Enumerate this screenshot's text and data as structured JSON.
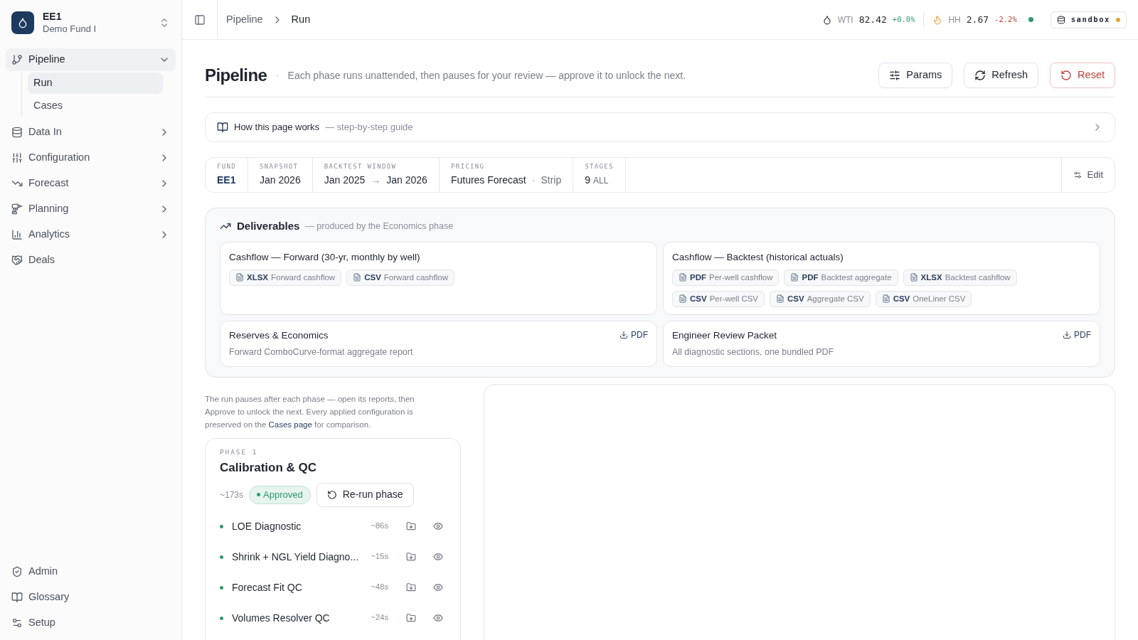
{
  "org": {
    "name": "EE1",
    "fund": "Demo Fund I"
  },
  "sidebar": {
    "items": [
      {
        "label": "Pipeline",
        "expanded": true,
        "selected": true,
        "children": [
          {
            "label": "Run",
            "selected": true
          },
          {
            "label": "Cases",
            "selected": false
          }
        ]
      },
      {
        "label": "Data In",
        "expanded": false,
        "selected": false
      },
      {
        "label": "Configuration",
        "expanded": false,
        "selected": false
      },
      {
        "label": "Forecast",
        "expanded": false,
        "selected": false
      },
      {
        "label": "Planning",
        "expanded": false,
        "selected": false
      },
      {
        "label": "Analytics",
        "expanded": false,
        "selected": false
      },
      {
        "label": "Deals",
        "selected": false
      }
    ],
    "footer": [
      {
        "label": "Admin"
      },
      {
        "label": "Glossary"
      },
      {
        "label": "Setup"
      }
    ]
  },
  "breadcrumb": [
    "Pipeline",
    "Run"
  ],
  "tickers": [
    {
      "label": "WTI",
      "price": "82.42",
      "change": "+0.0%",
      "rising": true
    },
    {
      "label": "HH",
      "price": "2.67",
      "change": "-2.2%",
      "rising": false
    }
  ],
  "live": true,
  "environment": {
    "label": "sandbox",
    "color": "#e8a33a"
  },
  "page": {
    "title": "Pipeline",
    "separator": "·",
    "subtitle": "Each phase runs unattended, then pauses for your review — approve it to unlock the next.",
    "actions": [
      {
        "label": "Params",
        "kind": "default"
      },
      {
        "label": "Refresh",
        "kind": "default"
      },
      {
        "label": "Reset",
        "kind": "danger"
      }
    ]
  },
  "guide": {
    "title": "How this page works",
    "subtitle": "— step-by-step guide"
  },
  "summary": {
    "fields": [
      {
        "label": "FUND",
        "value": "EE1",
        "kind": "accent"
      },
      {
        "label": "SNAPSHOT",
        "value": "Jan 2026",
        "kind": "text"
      },
      {
        "label": "BACKTEST WINDOW",
        "value": "Jan 2025",
        "arrow": "→",
        "value_to": "Jan 2026",
        "kind": "range"
      },
      {
        "label": "PRICING",
        "value": "Futures Forecast",
        "separator": "·",
        "note": "Strip",
        "kind": "text"
      },
      {
        "label": "STAGES",
        "value": "9",
        "note": "ALL",
        "kind": "count"
      }
    ],
    "edit": "Edit"
  },
  "deliverables": {
    "title": "Deliverables",
    "subtitle": "— produced by the Economics phase",
    "cards": [
      {
        "title": "Cashflow — Forward (30-yr, monthly by well)",
        "kind": "files",
        "files": [
          {
            "format": "XLSX",
            "label": "Forward cashflow"
          },
          {
            "format": "CSV",
            "label": "Forward cashflow"
          }
        ]
      },
      {
        "title": "Cashflow — Backtest (historical actuals)",
        "kind": "files",
        "files": [
          {
            "format": "PDF",
            "label": "Per-well cashflow"
          },
          {
            "format": "PDF",
            "label": "Backtest aggregate"
          },
          {
            "format": "XLSX",
            "label": "Backtest cashflow"
          },
          {
            "format": "CSV",
            "label": "Per-well CSV"
          },
          {
            "format": "CSV",
            "label": "Aggregate CSV"
          },
          {
            "format": "CSV",
            "label": "OneLiner CSV"
          }
        ]
      },
      {
        "title": "Reserves & Economics",
        "kind": "report",
        "description": "Forward ComboCurve-format aggregate report",
        "download": "PDF"
      },
      {
        "title": "Engineer Review Packet",
        "kind": "report",
        "description": "All diagnostic sections, one bundled PDF",
        "download": "PDF"
      }
    ]
  },
  "note": {
    "before": "The run pauses after each phase — open its reports, then Approve to unlock the next. Every applied configuration is preserved on the ",
    "link": "Cases page",
    "after": " for comparison."
  },
  "phase": {
    "label": "PHASE 1",
    "title": "Calibration & QC",
    "duration": "~173s",
    "approved": true,
    "status_label": "Approved",
    "rerun": "Re-run phase",
    "steps": [
      {
        "name": "LOE Diagnostic",
        "duration": "~86s",
        "done": true
      },
      {
        "name": "Shrink + NGL Yield Diagno...",
        "duration": "~15s",
        "done": true
      },
      {
        "name": "Forecast Fit QC",
        "duration": "~48s",
        "done": true
      },
      {
        "name": "Volumes Resolver QC",
        "duration": "~24s",
        "done": true
      }
    ]
  }
}
